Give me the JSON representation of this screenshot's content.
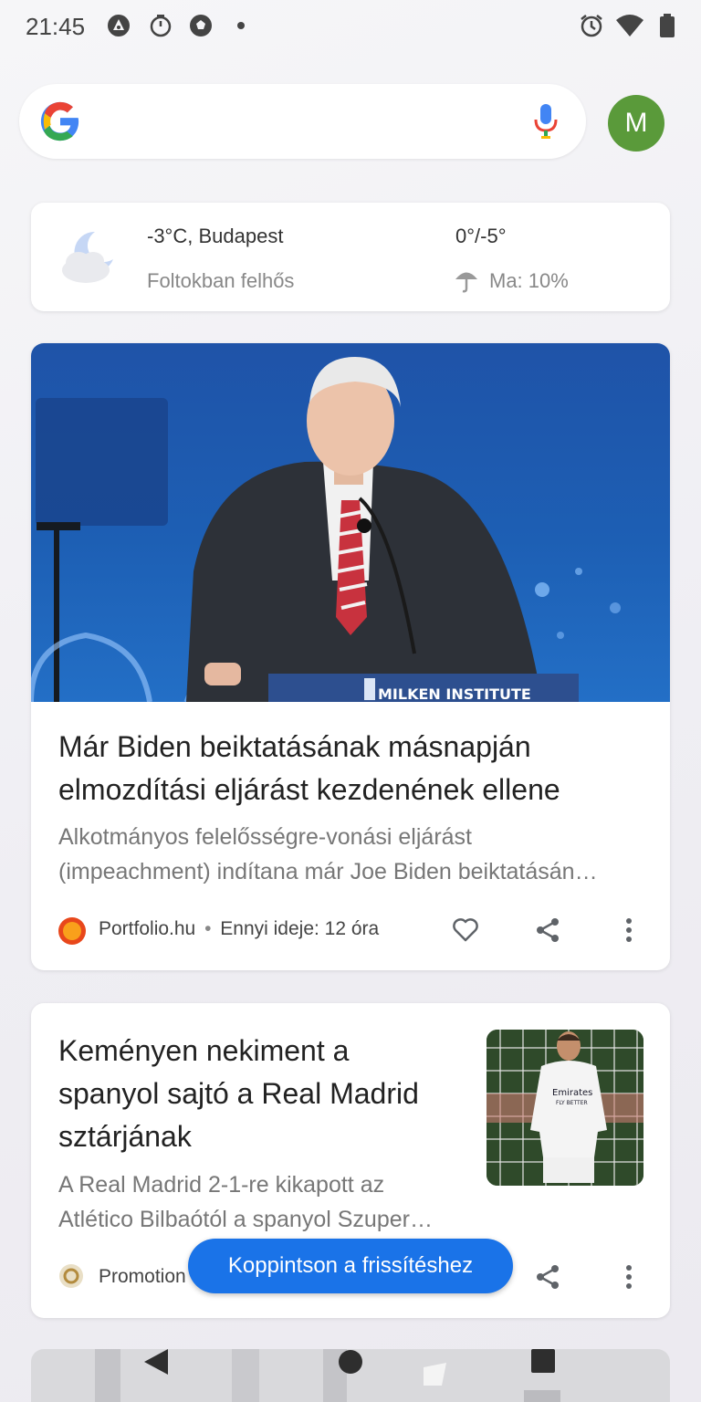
{
  "status_bar": {
    "time": "21:45",
    "left_icons": [
      "android-auto-icon",
      "timer-icon",
      "soccer-ball-icon",
      "notification-dot-icon"
    ],
    "right_icons": [
      "alarm-icon",
      "wifi-icon",
      "battery-icon"
    ]
  },
  "search": {
    "logo": "google-g-icon",
    "mic": "mic-icon",
    "avatar_letter": "M",
    "avatar_color": "#5a9a3a"
  },
  "weather": {
    "condition_icon": "partly-cloudy-night-icon",
    "temp_location": "-3°C, Budapest",
    "description": "Foltokban felhős",
    "range": "0°/-5°",
    "rain_icon": "umbrella-icon",
    "precip": "Ma: 10%"
  },
  "articles": [
    {
      "image": "biden-podium-photo",
      "image_caption": "MILKEN INSTITUTE",
      "headline_line1": "Már Biden beiktatásának másnapján",
      "headline_line2": "elmozdítási eljárást kezdenének ellene",
      "snippet_line1": "Alkotmányos felelősségre-vonási eljárást",
      "snippet_line2": "(impeachment) indítana már Joe Biden beiktatásán…",
      "source": "Portfolio.hu",
      "separator": "•",
      "time_ago": "Ennyi ideje: 12 óra",
      "source_color": "#f26a1b"
    },
    {
      "image": "football-player-thumbnail",
      "shirt_text": "Emirates",
      "shirt_sub": "FLY BETTER",
      "headline_line1": "Keményen nekiment a",
      "headline_line2": "spanyol sajtó a Real Madrid",
      "headline_line3": "sztárjának",
      "snippet_line1": "A Real Madrid 2-1-re kikapott az",
      "snippet_line2": "Atlético Bilbaótól a spanyol Szuper…",
      "source": "Promotion"
    }
  ],
  "toast": {
    "label": "Koppintson a frissítéshez",
    "color": "#1a73e8"
  },
  "nav": {
    "back": "back-icon",
    "home": "home-icon",
    "recents": "recents-icon"
  }
}
